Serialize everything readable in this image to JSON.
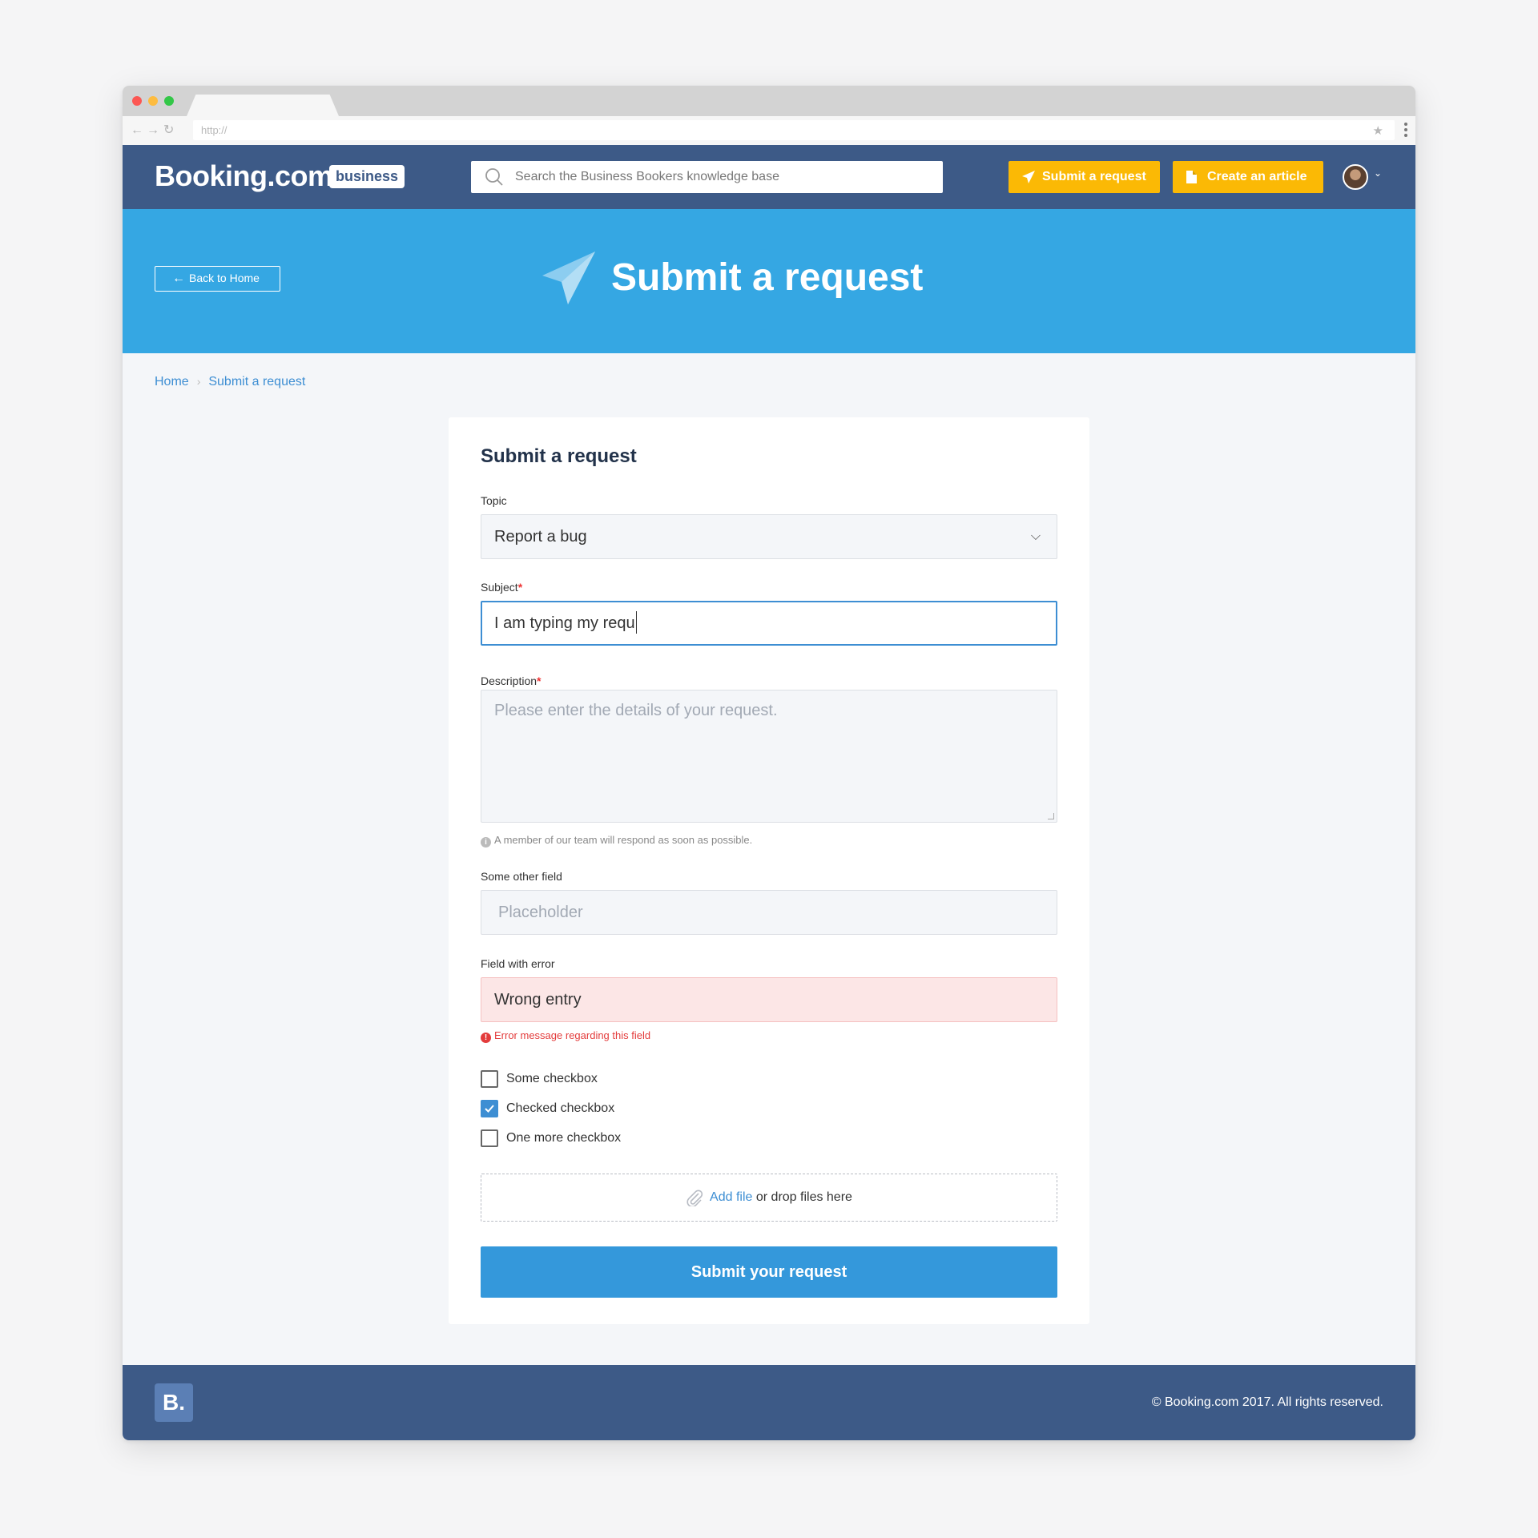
{
  "browser": {
    "url": "http://"
  },
  "navbar": {
    "brand": "Booking.com",
    "brand_badge": "business",
    "search_placeholder": "Search the Business Bookers knowledge base",
    "submit_label": "Submit a request",
    "article_label": "Create an article"
  },
  "hero": {
    "back_label": "Back to Home",
    "title": "Submit a request"
  },
  "breadcrumb": {
    "home": "Home",
    "current": "Submit a request"
  },
  "form": {
    "title": "Submit a request",
    "topic_label": "Topic",
    "topic_value": "Report a bug",
    "subject_label": "Subject",
    "subject_value": "I am typing my requ",
    "required_mark": "*",
    "description_label": "Description",
    "description_placeholder": "Please enter the details of your request.",
    "description_hint": "A member of our team will respond as soon as possible.",
    "other_label": "Some other field",
    "other_placeholder": "Placeholder",
    "error_label": "Field with error",
    "error_value": "Wrong entry",
    "error_message": "Error message regarding this field",
    "checkboxes": [
      {
        "label": "Some checkbox",
        "checked": false
      },
      {
        "label": "Checked checkbox",
        "checked": true
      },
      {
        "label": "One more checkbox",
        "checked": false
      }
    ],
    "dropzone_link": "Add file",
    "dropzone_text": " or drop files here",
    "submit_label": "Submit your request"
  },
  "footer": {
    "logo": "B.",
    "copyright": "© Booking.com 2017. All rights reserved."
  },
  "colors": {
    "navy": "#3d5a87",
    "sky": "#35a7e3",
    "yellow": "#fbb905",
    "link": "#3d8ed3",
    "error": "#e33c3c"
  }
}
